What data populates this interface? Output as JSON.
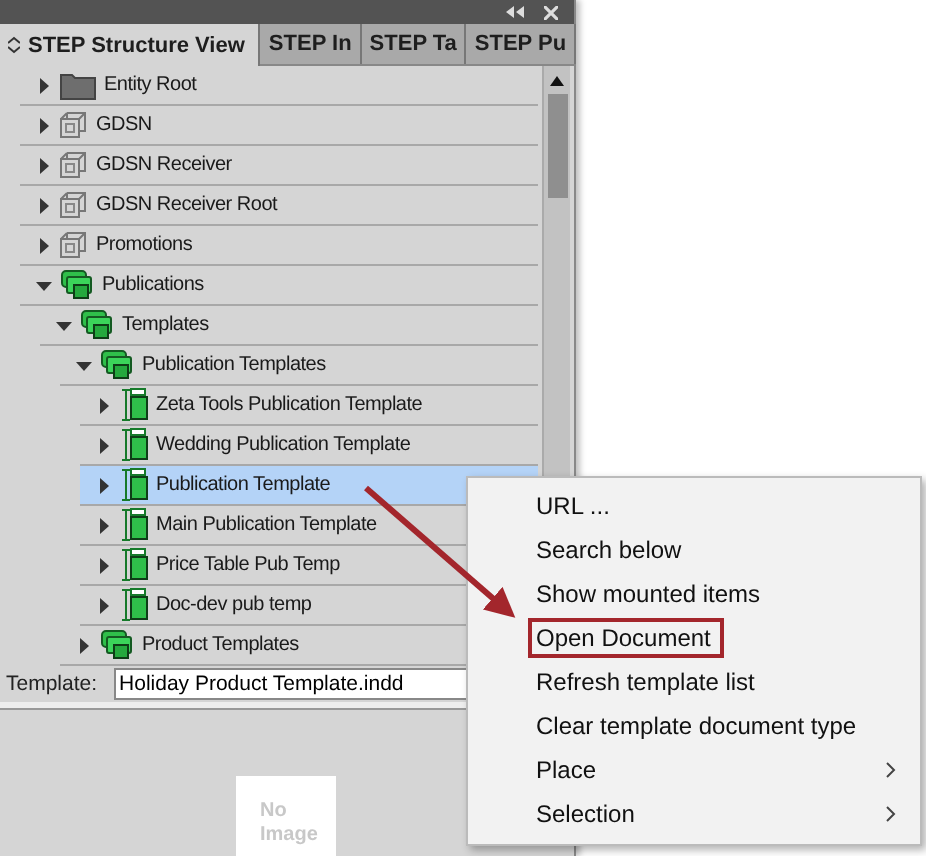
{
  "tabs": [
    {
      "label": "STEP Structure View",
      "selected": true
    },
    {
      "label": "STEP In",
      "selected": false
    },
    {
      "label": "STEP Ta",
      "selected": false
    },
    {
      "label": "STEP Pu",
      "selected": false
    }
  ],
  "tree": [
    {
      "label": "Entity Root",
      "kind": "folder",
      "expanded": false,
      "selected": false
    },
    {
      "label": "GDSN",
      "kind": "module",
      "expanded": false,
      "selected": false
    },
    {
      "label": "GDSN Receiver",
      "kind": "module",
      "expanded": false,
      "selected": false
    },
    {
      "label": "GDSN Receiver Root",
      "kind": "module",
      "expanded": false,
      "selected": false
    },
    {
      "label": "Promotions",
      "kind": "module",
      "expanded": false,
      "selected": false
    },
    {
      "label": "Publications",
      "kind": "group",
      "expanded": true,
      "selected": false,
      "children": [
        {
          "label": "Templates",
          "kind": "group",
          "expanded": true,
          "selected": false,
          "children": [
            {
              "label": "Publication Templates",
              "kind": "group",
              "expanded": true,
              "selected": false,
              "children": [
                {
                  "label": "Zeta Tools Publication Template",
                  "kind": "template",
                  "expanded": false,
                  "selected": false
                },
                {
                  "label": "Wedding Publication Template",
                  "kind": "template",
                  "expanded": false,
                  "selected": false
                },
                {
                  "label": "Publication Template",
                  "kind": "template",
                  "expanded": false,
                  "selected": true
                },
                {
                  "label": "Main Publication Template",
                  "kind": "template",
                  "expanded": false,
                  "selected": false
                },
                {
                  "label": "Price Table Pub Temp",
                  "kind": "template",
                  "expanded": false,
                  "selected": false
                },
                {
                  "label": "Doc-dev pub temp",
                  "kind": "template",
                  "expanded": false,
                  "selected": false
                }
              ]
            },
            {
              "label": "Product Templates",
              "kind": "group",
              "expanded": false,
              "selected": false
            }
          ]
        }
      ]
    }
  ],
  "template_field": {
    "label": "Template:",
    "value": "Holiday Product Template.indd"
  },
  "preview": {
    "text": "No Image"
  },
  "context_menu": [
    {
      "label": "URL ...",
      "highlighted": false,
      "submenu": false
    },
    {
      "label": "Search below",
      "highlighted": false,
      "submenu": false
    },
    {
      "label": "Show mounted items",
      "highlighted": false,
      "submenu": false
    },
    {
      "label": "Open Document",
      "highlighted": true,
      "submenu": false
    },
    {
      "label": "Refresh template list",
      "highlighted": false,
      "submenu": false
    },
    {
      "label": "Clear template document type",
      "highlighted": false,
      "submenu": false
    },
    {
      "label": "Place",
      "highlighted": false,
      "submenu": true
    },
    {
      "label": "Selection",
      "highlighted": false,
      "submenu": true
    }
  ]
}
